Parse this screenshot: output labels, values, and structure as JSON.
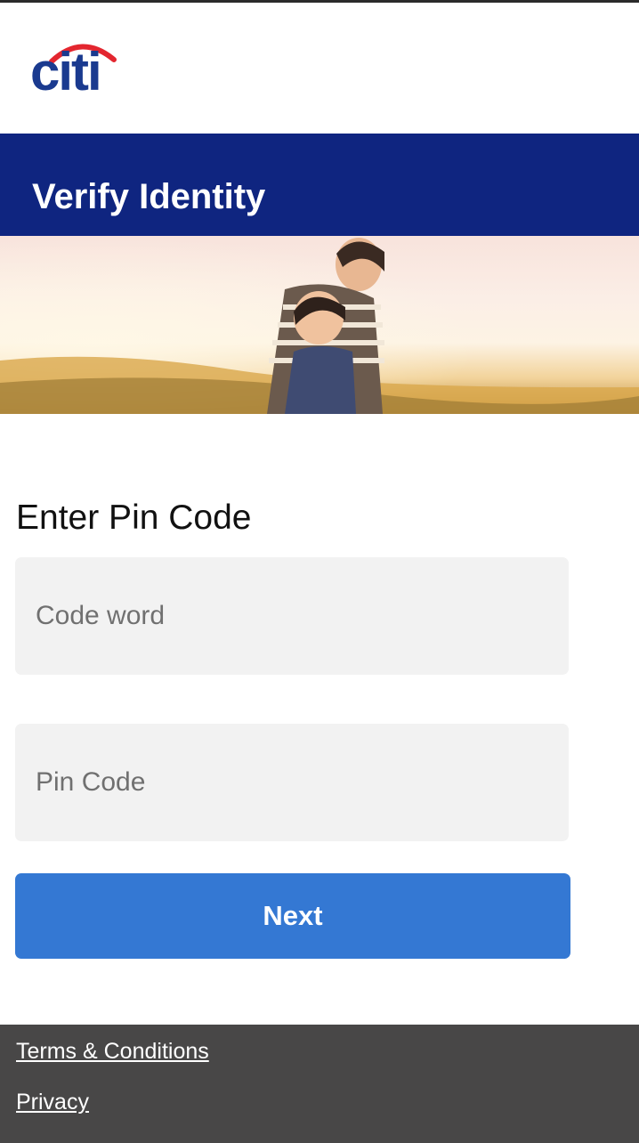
{
  "brand": {
    "logo_text": "citi",
    "logo_color": "#1a3a8f",
    "arc_color": "#e3262f"
  },
  "banner": {
    "title": "Verify Identity",
    "background": "#0f2580"
  },
  "form": {
    "heading": "Enter Pin Code",
    "code_word": {
      "placeholder": "Code word",
      "value": ""
    },
    "pin_code": {
      "placeholder": "Pin Code",
      "value": ""
    },
    "next_label": "Next",
    "button_color": "#3478d3"
  },
  "footer": {
    "links": [
      {
        "label": "Terms & Conditions"
      },
      {
        "label": "Privacy"
      }
    ]
  }
}
